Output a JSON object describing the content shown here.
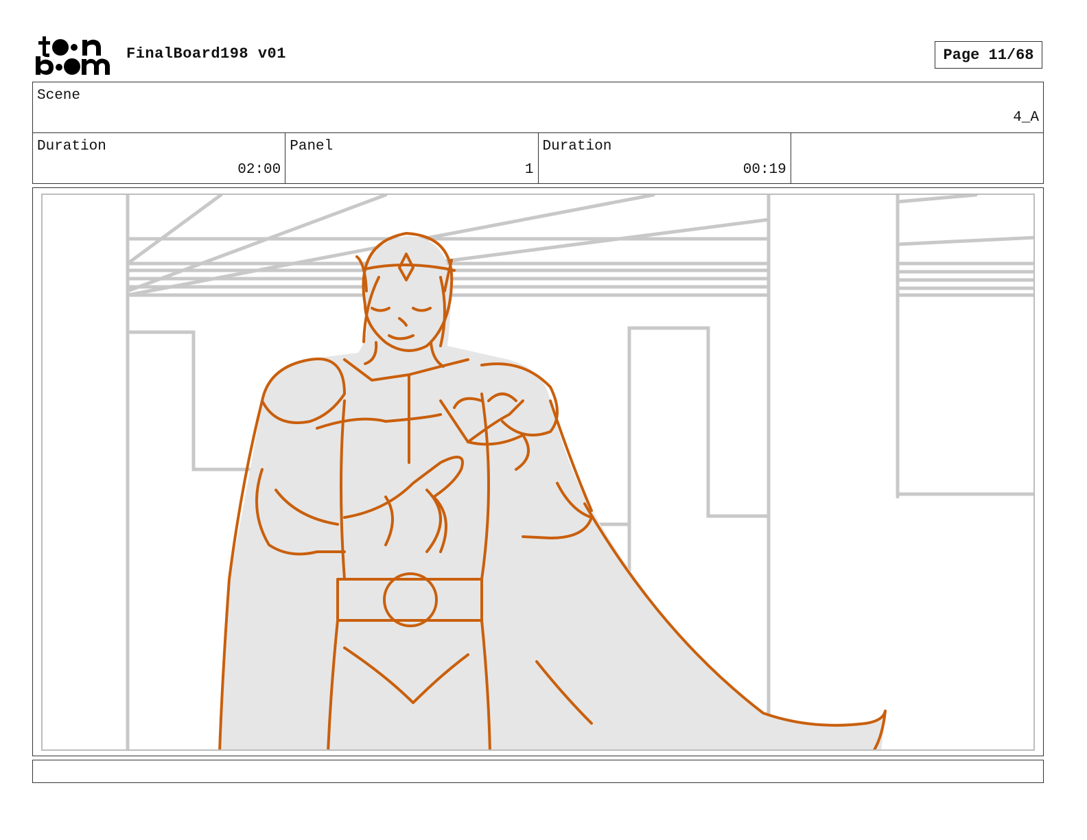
{
  "header": {
    "logo_text": "toonboom",
    "title": "FinalBoard198 v01",
    "page": "Page 11/68"
  },
  "scene": {
    "label": "Scene",
    "value": "4_A"
  },
  "fields": [
    {
      "label": "Duration",
      "value": "02:00"
    },
    {
      "label": "Panel",
      "value": "1"
    },
    {
      "label": "Duration",
      "value": "00:19"
    },
    {
      "label": "",
      "value": ""
    }
  ],
  "notes": {
    "text": ""
  },
  "colors": {
    "line": "#c95f0c",
    "fill": "#e6e6e6",
    "background_lines": "#c8c8c8"
  },
  "illustration": "storyboard-sketch"
}
